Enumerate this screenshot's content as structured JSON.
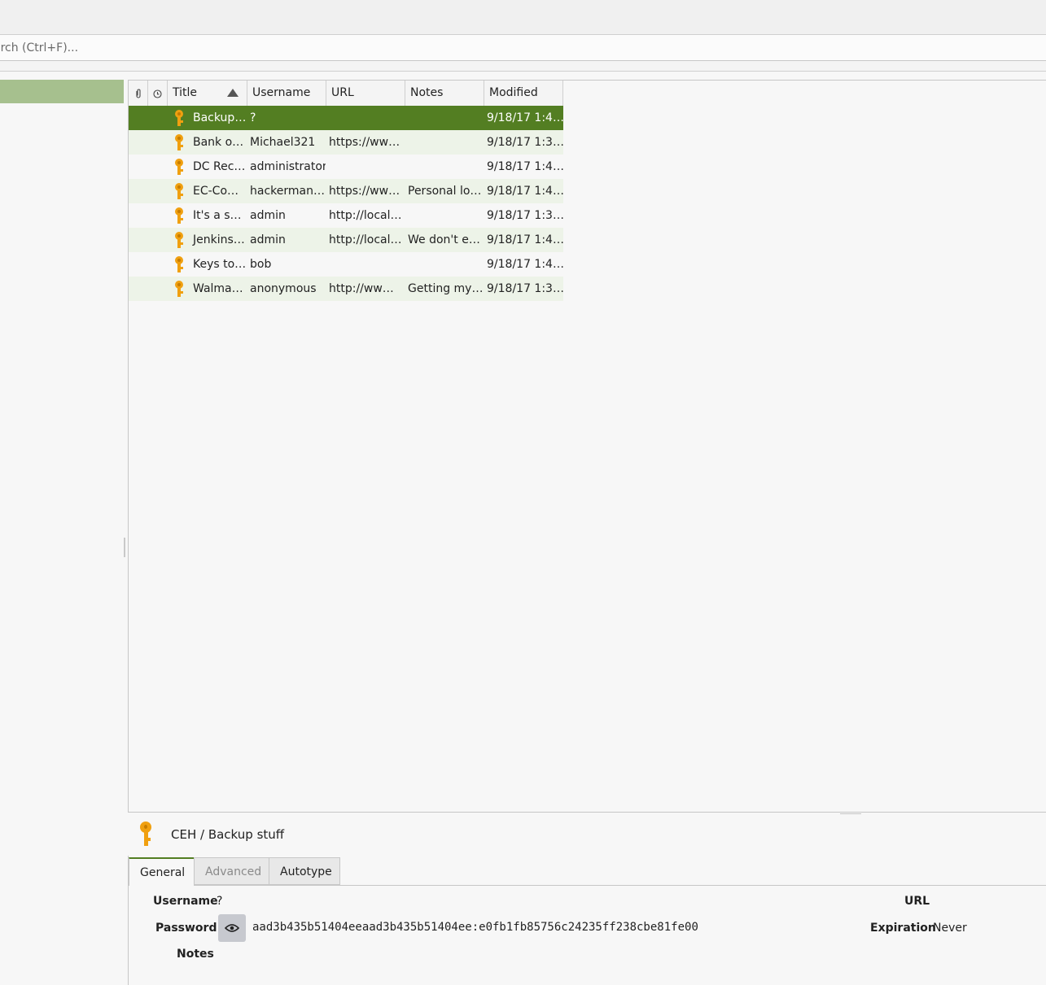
{
  "search": {
    "placeholder": "arch (Ctrl+F)..."
  },
  "table": {
    "headers": {
      "attachment_icon": "paperclip-icon",
      "expire_icon": "clock-icon",
      "title": "Title",
      "username": "Username",
      "url": "URL",
      "notes": "Notes",
      "modified": "Modified"
    },
    "rows": [
      {
        "title": "Backup…",
        "username": "?",
        "url": "",
        "notes": "",
        "modified": "9/18/17 1:4…",
        "selected": true
      },
      {
        "title": "Bank o…",
        "username": "Michael321",
        "url": "https://ww…",
        "notes": "",
        "modified": "9/18/17 1:3…"
      },
      {
        "title": "DC Rec…",
        "username": "administrator",
        "url": "",
        "notes": "",
        "modified": "9/18/17 1:4…"
      },
      {
        "title": "EC-Co…",
        "username": "hackerman…",
        "url": "https://ww…",
        "notes": "Personal lo…",
        "modified": "9/18/17 1:4…"
      },
      {
        "title": "It's a s…",
        "username": "admin",
        "url": "http://local…",
        "notes": "",
        "modified": "9/18/17 1:3…"
      },
      {
        "title": "Jenkins…",
        "username": "admin",
        "url": "http://local…",
        "notes": "We don't e…",
        "modified": "9/18/17 1:4…"
      },
      {
        "title": "Keys to…",
        "username": "bob",
        "url": "",
        "notes": "",
        "modified": "9/18/17 1:4…"
      },
      {
        "title": "Walma…",
        "username": "anonymous",
        "url": "http://ww…",
        "notes": "Getting my…",
        "modified": "9/18/17 1:3…"
      }
    ]
  },
  "details": {
    "path": "CEH / Backup stuff",
    "tabs": {
      "general": "General",
      "advanced": "Advanced",
      "autotype": "Autotype"
    },
    "labels": {
      "username": "Username",
      "password": "Password",
      "notes": "Notes",
      "url": "URL",
      "expiration": "Expiration"
    },
    "values": {
      "username": "?",
      "password": "aad3b435b51404eeaad3b435b51404ee:e0fb1fb85756c24235ff238cbe81fe00",
      "url": "",
      "expiration": "Never"
    }
  },
  "colors": {
    "selection": "#537e22",
    "group_selection": "#a6c08e",
    "alt_row": "#edf3e8",
    "key_icon": "#f0a010"
  }
}
